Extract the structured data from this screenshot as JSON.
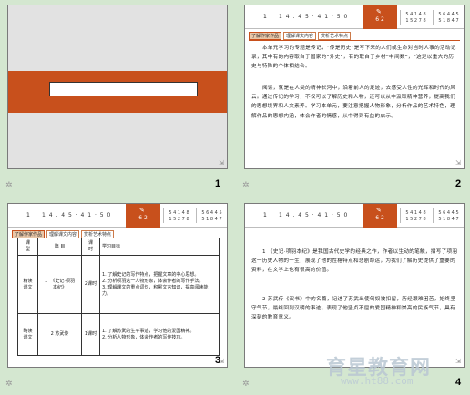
{
  "slides": [
    {
      "number": "1",
      "corner": "⇲"
    },
    {
      "number": "2",
      "header": {
        "num": "1",
        "title": "1 4 . 4 5 · 4 1 · 5 0",
        "orange": "6 2",
        "tab1": "5 4 1 4 8\n1 5 2 7 8",
        "tab2": "5 6 4 4 5\n5 1 8 4 7"
      },
      "tabs": [
        "了解作家作品",
        "理解课文内容",
        "赏析艺术特点"
      ],
      "paragraphs": [
        "本单元学习的专题是传记，“传是历史”是写下来的人们或生命对当时人事的活动记录，其中有的内容取自于国家的“外史”，有的取自于乡村“中间数”，“这是以重大的历史与特殊的个体相结合。",
        "阅读，就是在人类的精神长河中，沿着前人的足迹，去感受人性的光辉和时代的风云。通过传记的学习，不仅可以了解历史和人物，还可以从中汲取精神营养，提高我们的思想境界和人文素养。学习本单元，要注意把握人物形象，分析作品的艺术特色，理解作品的思想内涵，体会作者的情感，从中得到有益的启示。"
      ],
      "corner": "⇲"
    },
    {
      "number": "3",
      "header": {
        "num": "1",
        "title": "1 4 . 4 5 · 4 1 · 5 0",
        "orange": "6 2",
        "tab1": "5 4 1 4 8\n1 5 2 7 8",
        "tab2": "5 6 4 4 5\n5 1 8 4 7"
      },
      "tabs": [
        "了解作家作品",
        "理解课文内容",
        "赏析艺术特点"
      ],
      "table": {
        "head": [
          "课\n型",
          "篇  目",
          "课\n时",
          "学习目标"
        ],
        "rows": [
          [
            "精读\n课文",
            "1  《史记·项羽\n本纪》",
            "2课时",
            "1. 了解史记的写作特点，把握文章的中心思想。\n2. 分析项羽这一人物形象，体会作者的写作手法。\n3. 理解课文的重点词句，积累文言知识，提高阅读能力。"
          ],
          [
            "略读\n课文",
            "2  苏武传",
            "1课时",
            "1. 了解苏武的生平事迹，学习他的爱国精神。\n2. 分析人物形象，体会作者的写作技巧。"
          ]
        ]
      },
      "corner": "⇲"
    },
    {
      "number": "4",
      "header": {
        "num": "1",
        "title": "1 4 . 4 5 · 4 1 · 5 0",
        "orange": "6 2",
        "tab1": "5 4 1 4 8\n1 5 2 7 8",
        "tab2": "5 6 4 4 5\n5 1 8 4 7"
      },
      "paragraphs": [
        "1 《史记·项羽本纪》是我国古代史学的经典之作，作者以生动的笔触，描写了项羽这一历史人物的一生，展现了他的性格特点和悲剧命运，为我们了解历史提供了重要的资料，在文学上也有很高的价值。",
        "2 苏武传《汉书》中的名篇，记述了苏武出使匈奴被扣留，历经艰难困苦，始终坚守气节，最终回到汉朝的事迹，表现了他坚贞不屈的爱国精神和崇高的民族气节，具有深刻的教育意义。"
      ],
      "corner": "⇲"
    }
  ],
  "watermark": {
    "logo": "育星教育网",
    "url": "www.ht88.com"
  }
}
